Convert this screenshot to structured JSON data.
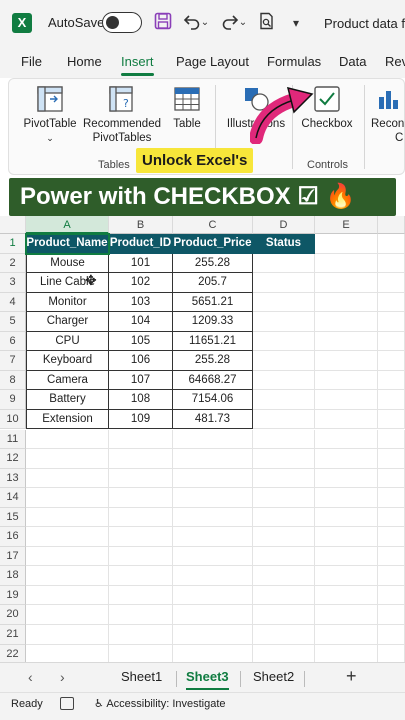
{
  "titlebar": {
    "app_icon": "excel-logo-icon",
    "app_letter": "X",
    "autosave_label": "AutoSave",
    "autosave_on": false,
    "save_icon": "save-icon",
    "undo_icon": "undo-icon",
    "redo_icon": "redo-icon",
    "print_icon": "print-preview-icon",
    "customize_icon": "chevron-down-icon",
    "document_title": "Product data fo"
  },
  "tabs": [
    "File",
    "Home",
    "Insert",
    "Page Layout",
    "Formulas",
    "Data",
    "Rev"
  ],
  "active_tab": "Insert",
  "ribbon": {
    "pivot_table": "PivotTable",
    "recommended_pivot_line1": "Recommended",
    "recommended_pivot_line2": "PivotTables",
    "table": "Table",
    "tables_group": "Tables",
    "illustrations": "Illustrations",
    "checkbox": "Checkbox",
    "controls_group": "Controls",
    "recommended_charts_line1": "Recon",
    "recommended_charts_line2": "C"
  },
  "captions": {
    "small": "Unlock Excel's",
    "big": "Power with CHECKBOX ☑ 🔥"
  },
  "grid": {
    "columns": [
      "A",
      "B",
      "C",
      "D",
      "E"
    ],
    "row_numbers": [
      "1",
      "2",
      "3",
      "4",
      "5",
      "6",
      "7",
      "8",
      "9",
      "10",
      "11",
      "12",
      "13",
      "14",
      "15",
      "16",
      "17",
      "18",
      "19",
      "20",
      "21",
      "22"
    ],
    "headers": [
      "Product_Name",
      "Product_ID",
      "Product_Price",
      "Status"
    ],
    "rows": [
      [
        "Mouse",
        "101",
        "255.28"
      ],
      [
        "Line Cable",
        "102",
        "205.7"
      ],
      [
        "Monitor",
        "103",
        "5651.21"
      ],
      [
        "Charger",
        "104",
        "1209.33"
      ],
      [
        "CPU",
        "105",
        "11651.21"
      ],
      [
        "Keyboard",
        "106",
        "255.28"
      ],
      [
        "Camera",
        "107",
        "64668.27"
      ],
      [
        "Battery",
        "108",
        "7154.06"
      ],
      [
        "Extension",
        "109",
        "481.73"
      ]
    ]
  },
  "sheets": [
    "Sheet1",
    "Sheet3",
    "Sheet2"
  ],
  "active_sheet": "Sheet3",
  "statusbar": {
    "ready": "Ready",
    "accessibility": "Accessibility: Investigate"
  },
  "colors": {
    "accent": "#107c41",
    "header_fill": "#0e5766",
    "caption_yellow": "#f7e63a",
    "caption_green": "#2f5d2a",
    "arrow_pink": "#e0287a"
  }
}
